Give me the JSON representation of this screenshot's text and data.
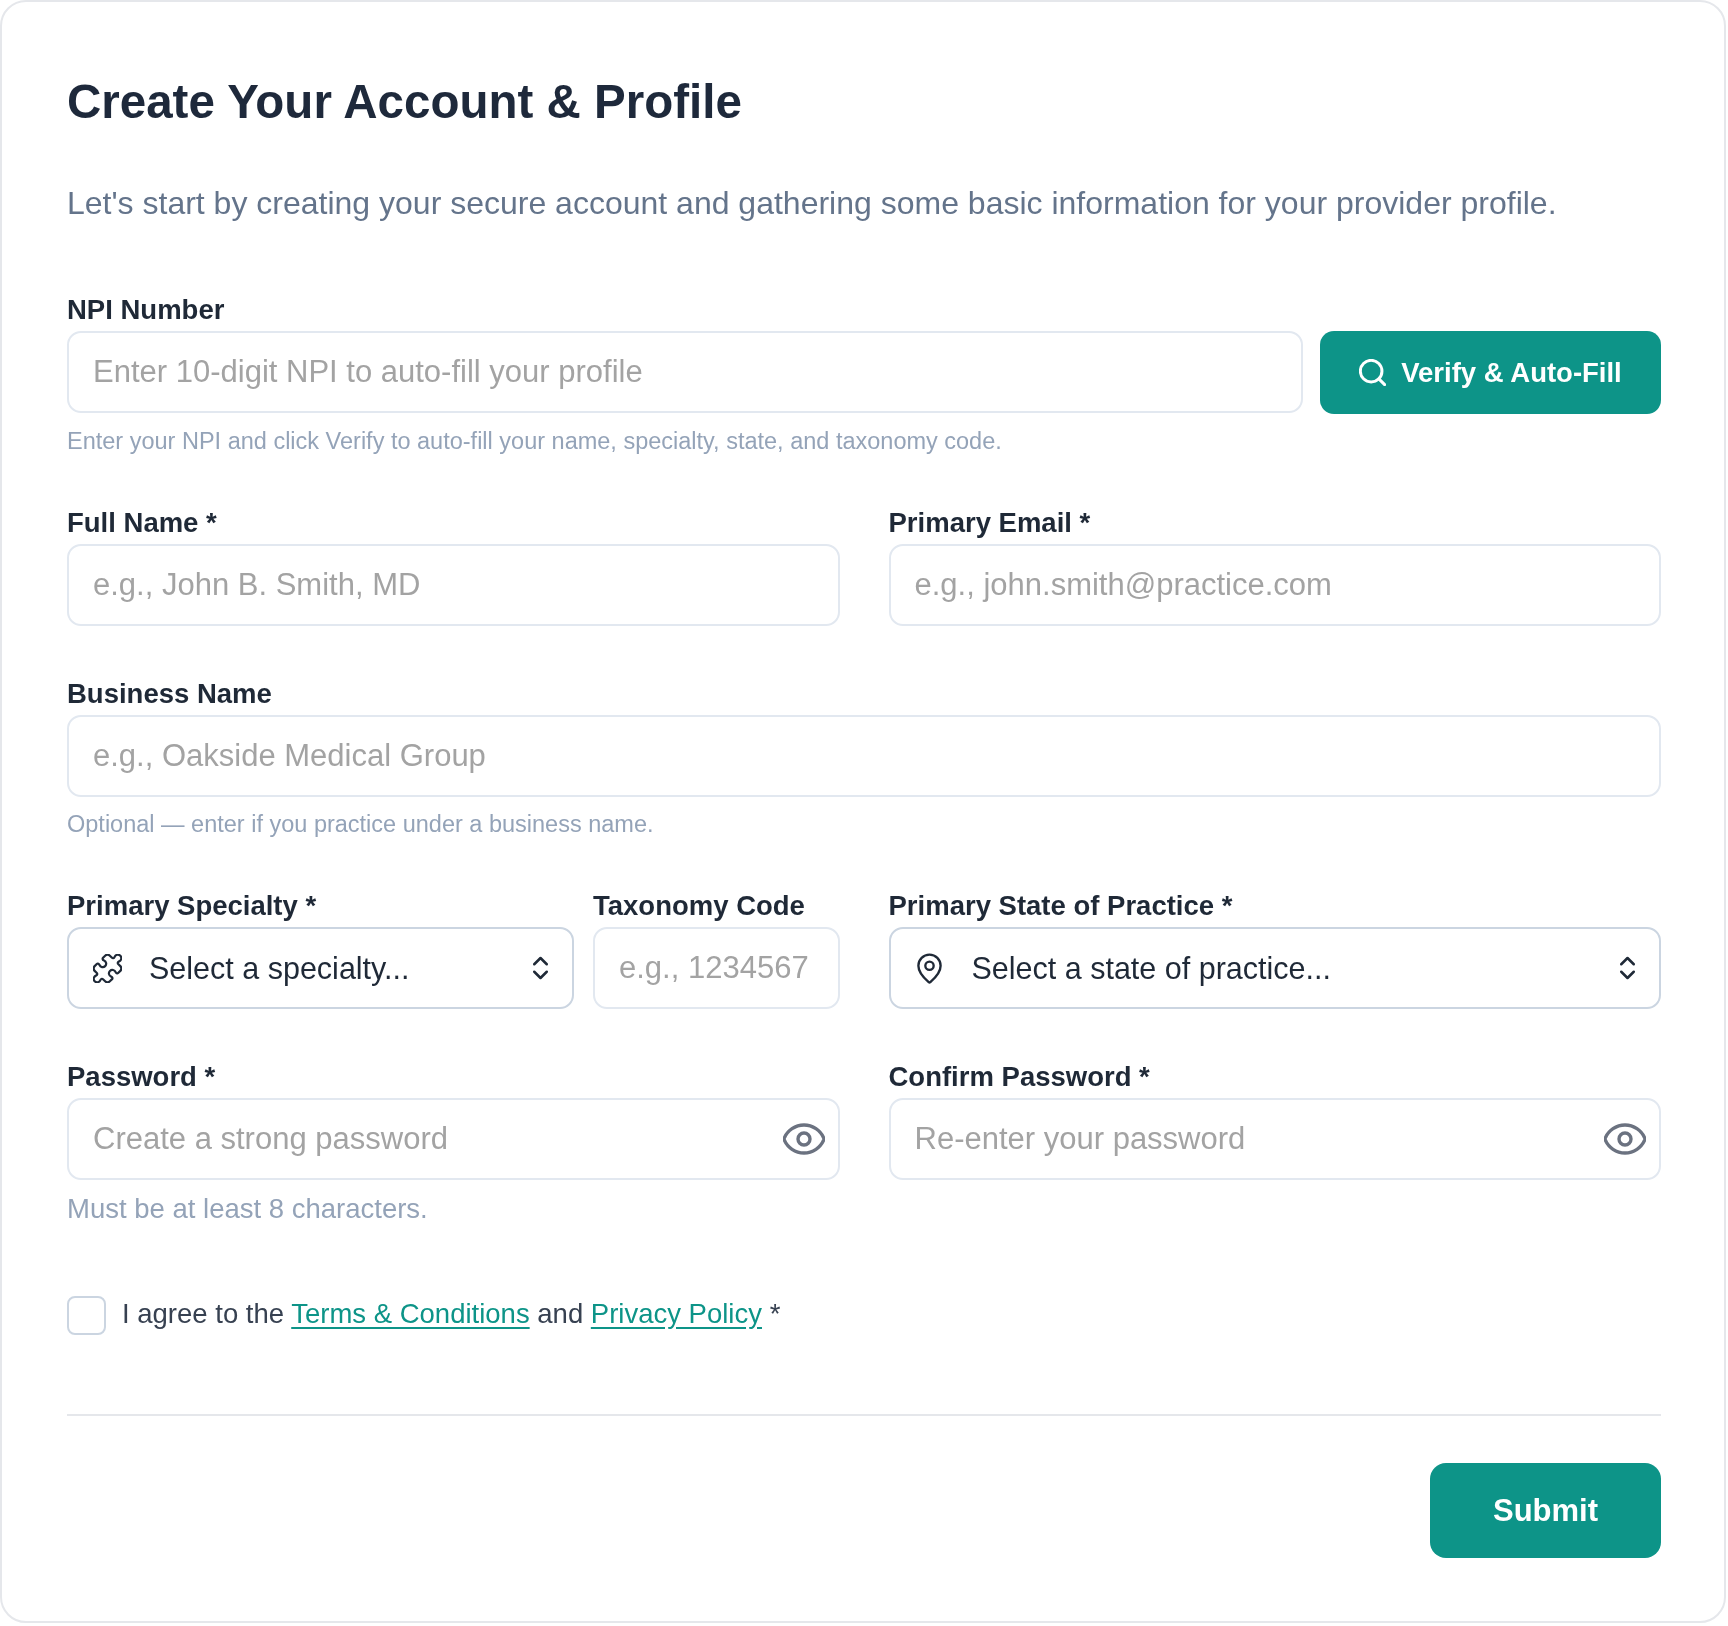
{
  "title": "Create Your Account & Profile",
  "subtitle": "Let's start by creating your secure account and gathering some basic information for your provider profile.",
  "npi": {
    "label": "NPI Number",
    "placeholder": "Enter 10-digit NPI to auto-fill your profile",
    "button": "Verify & Auto-Fill",
    "hint": "Enter your NPI and click Verify to auto-fill your name, specialty, state, and taxonomy code."
  },
  "full_name": {
    "label": "Full Name *",
    "placeholder": "e.g., John B. Smith, MD"
  },
  "primary_email": {
    "label": "Primary Email *",
    "placeholder": "e.g., john.smith@practice.com"
  },
  "business_name": {
    "label": "Business Name",
    "placeholder": "e.g., Oakside Medical Group",
    "hint": "Optional — enter if you practice under a business name."
  },
  "primary_specialty": {
    "label": "Primary Specialty *",
    "placeholder": "Select a specialty..."
  },
  "taxonomy_code": {
    "label": "Taxonomy Code",
    "placeholder": "e.g., 1234567"
  },
  "primary_state": {
    "label": "Primary State of Practice *",
    "placeholder": "Select a state of practice..."
  },
  "password": {
    "label": "Password *",
    "placeholder": "Create a strong password",
    "hint": "Must be at least 8 characters."
  },
  "confirm_password": {
    "label": "Confirm Password *",
    "placeholder": "Re-enter your password"
  },
  "consent": {
    "checked": false,
    "parts": [
      {
        "kind": "text",
        "text": "I agree to the"
      },
      {
        "kind": "link",
        "text": "Terms & Conditions"
      },
      {
        "kind": "text",
        "text": "and"
      },
      {
        "kind": "link",
        "text": "Privacy Policy"
      },
      {
        "kind": "text",
        "text": "*"
      }
    ]
  },
  "submit": "Submit"
}
